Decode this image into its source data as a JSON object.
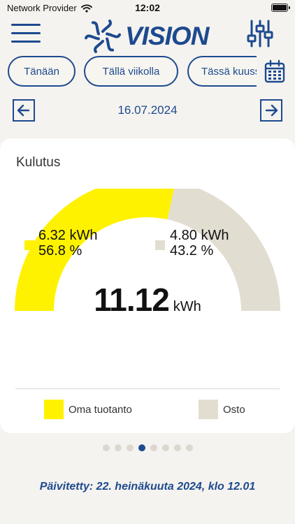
{
  "status_bar": {
    "carrier": "Network Provider",
    "time": "12:02"
  },
  "header": {
    "logo_text": "VISION"
  },
  "tabs": [
    {
      "label": "Tänään"
    },
    {
      "label": "Tällä viikolla"
    },
    {
      "label": "Tässä kuussa"
    }
  ],
  "date_nav": {
    "date": "16.07.2024"
  },
  "card": {
    "title": "Kulutus",
    "own": {
      "kwh": "6.32 kWh",
      "percent": "56.8 %",
      "fraction": 0.568
    },
    "purchase": {
      "kwh": "4.80 kWh",
      "percent": "43.2 %",
      "fraction": 0.432
    },
    "total_value": "11.12",
    "total_unit": "kWh",
    "legend": [
      {
        "label": "Oma tuotanto"
      },
      {
        "label": "Osto"
      }
    ]
  },
  "colors": {
    "own": "#fff200",
    "purchase": "#e2ddd1",
    "accent": "#1d4a8f"
  },
  "pager": {
    "count": 8,
    "active": 3
  },
  "footer": {
    "updated": "Päivitetty: 22. heinäkuuta 2024, klo 12.01"
  }
}
